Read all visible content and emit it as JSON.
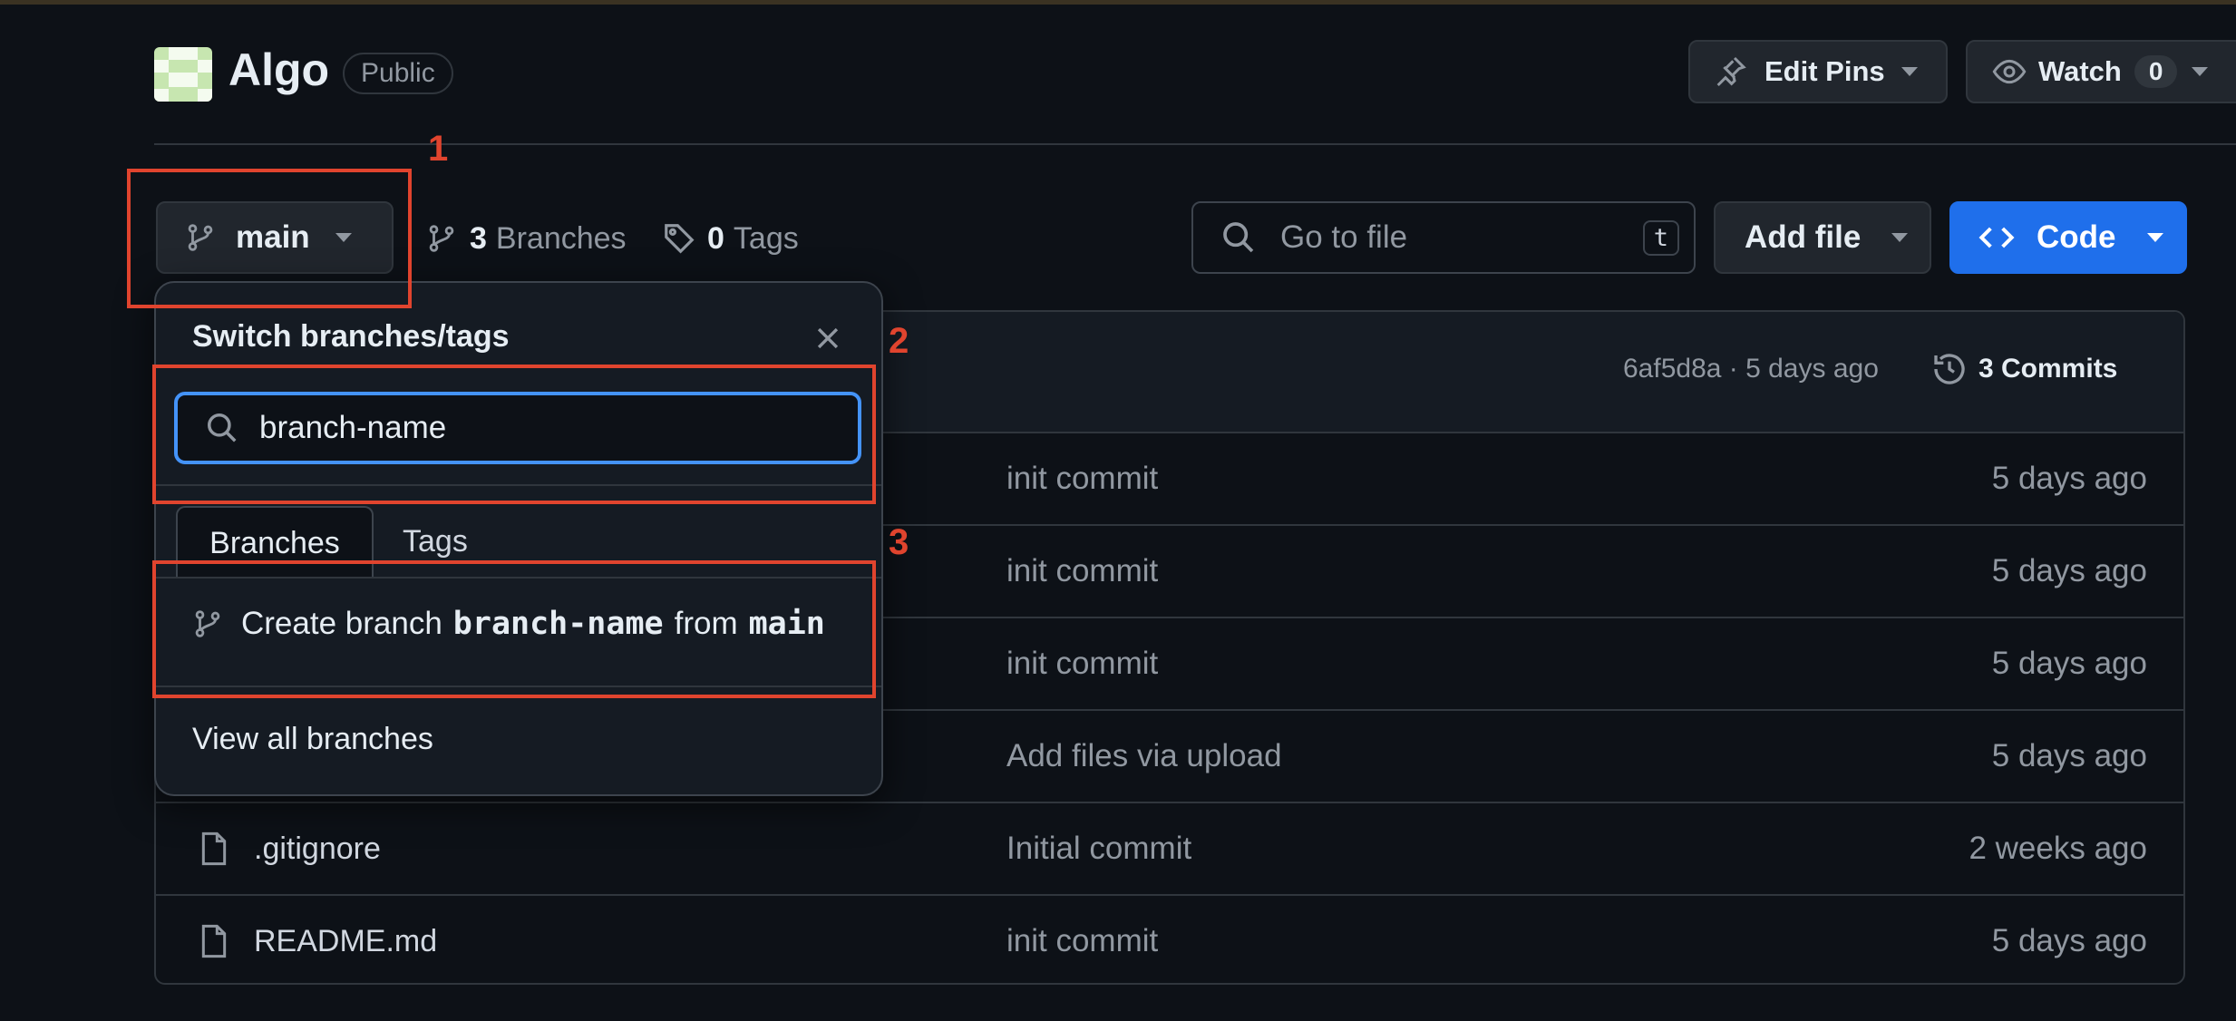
{
  "repo": {
    "name": "Algo",
    "visibility": "Public"
  },
  "header_actions": {
    "edit_pins": "Edit Pins",
    "watch": "Watch",
    "watch_count": "0"
  },
  "branch_bar": {
    "current_branch": "main",
    "branches_count": "3",
    "branches_label": "Branches",
    "tags_count": "0",
    "tags_label": "Tags",
    "goto_placeholder": "Go to file",
    "goto_shortcut": "t",
    "add_file": "Add file",
    "code": "Code"
  },
  "latest_commit": {
    "hash_age": "6af5d8a · 5 days ago",
    "commits": "3 Commits"
  },
  "files": [
    {
      "name": "",
      "message": "init commit",
      "age": "5 days ago"
    },
    {
      "name": "",
      "message": "init commit",
      "age": "5 days ago"
    },
    {
      "name": "",
      "message": "init commit",
      "age": "5 days ago"
    },
    {
      "name": "",
      "message": "Add files via upload",
      "age": "5 days ago"
    },
    {
      "name": ".gitignore",
      "message": "Initial commit",
      "age": "2 weeks ago"
    },
    {
      "name": "README.md",
      "message": "init commit",
      "age": "5 days ago"
    }
  ],
  "dropdown": {
    "title": "Switch branches/tags",
    "search_value": "branch-name",
    "tabs": [
      "Branches",
      "Tags"
    ],
    "create_prefix": "Create branch",
    "create_branch": "branch-name",
    "create_from": "from",
    "create_source": "main",
    "view_all": "View all branches"
  },
  "annotations": [
    "1",
    "2",
    "3"
  ],
  "colors": {
    "background": "#0d1117",
    "accent_blue": "#1f6feb",
    "annotation_red": "#e0442e",
    "focus_ring": "#4493f8"
  }
}
